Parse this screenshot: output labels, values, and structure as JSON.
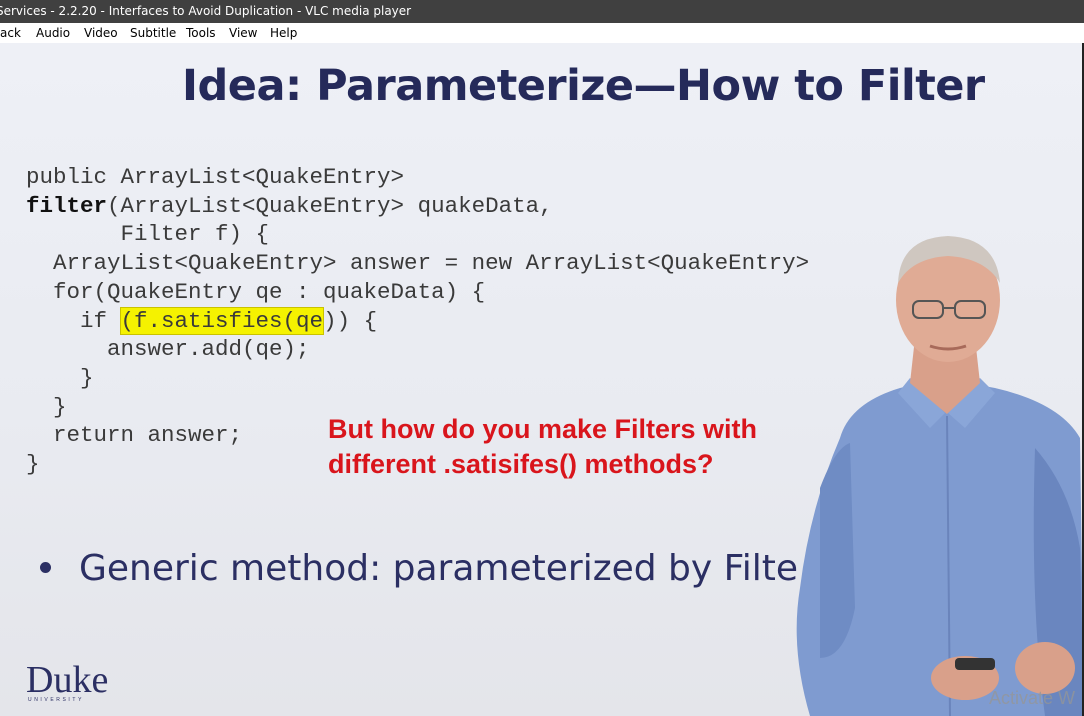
{
  "window": {
    "title": "Services - 2.2.20 - Interfaces to Avoid Duplication - VLC media player"
  },
  "menu": {
    "items": [
      "ack",
      "Audio",
      "Video",
      "Subtitle",
      "Tools",
      "View",
      "Help"
    ]
  },
  "slide": {
    "title": "Idea: Parameterize—How to Filter",
    "code": {
      "line1": "public ArrayList<QuakeEntry>",
      "line2_kw": "filter",
      "line2_rest": "(ArrayList<QuakeEntry> quakeData,",
      "line3": "       Filter f) {",
      "line4": "  ArrayList<QuakeEntry> answer = new ArrayList<QuakeEntry>",
      "line5": "  for(QuakeEntry qe : quakeData) {",
      "line6_pre": "    if ",
      "line6_hl": "(f.satisfies(qe",
      "line6_post": ")) {",
      "line7": "      answer.add(qe);",
      "line8": "    }",
      "line9": "  }",
      "line10": "  return answer;",
      "line11": "}"
    },
    "callout_line1": "But how do you make Filters with",
    "callout_line2": "different .satisifes() methods?",
    "bullet": "Generic method: parameterized by Filte",
    "logo_name": "Duke",
    "logo_sub": "UNIVERSITY"
  },
  "watermark": "Activate W"
}
